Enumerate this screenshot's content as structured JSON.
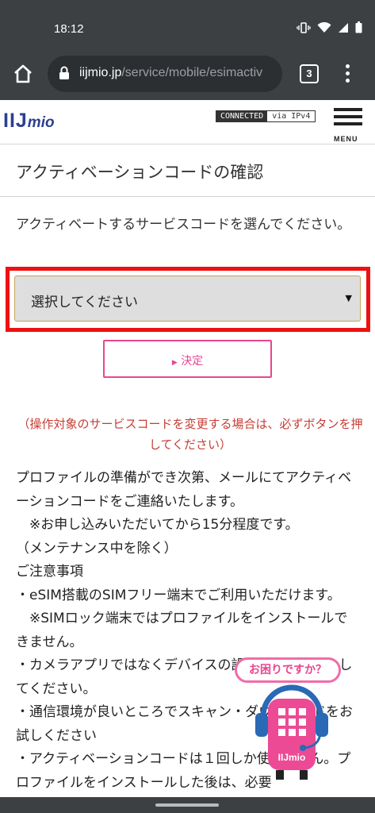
{
  "status_bar": {
    "time": "18:12"
  },
  "browser": {
    "url_host": "iijmio.jp",
    "url_path": "/service/mobile/esimactiv",
    "tab_count": "3"
  },
  "site": {
    "logo_main": "IIJ",
    "logo_sub": "mio",
    "connected_label": "CONNECTED",
    "connected_via": "via IPv4",
    "menu_label": "MENU"
  },
  "page": {
    "title": "アクティベーションコードの確認",
    "instruction": "アクティベートするサービスコードを選んでください。",
    "select_value": "選択してください",
    "submit_label": "決定",
    "warning": "（操作対象のサービスコードを変更する場合は、必ずボタンを押してください）",
    "body": [
      "プロファイルの準備ができ次第、メールにてアクティベーションコードをご連絡いたします。",
      "　※お申し込みいただいてから15分程度です。",
      "（メンテナンス中を除く）",
      "ご注意事項",
      "・eSIM搭載のSIMフリー端末でご利用いただけます。",
      "　※SIMロック端末ではプロファイルをインストールできません。",
      "・カメラアプリではなくデバイスの設定からスキャンしてください。",
      "・通信環境が良いところでスキャン・ダウンロードをお試しください",
      "・アクティベーションコードは１回しか使えません。プロファイルをインストールした後は、必要"
    ]
  },
  "help_widget": {
    "bubble_text": "お困りですか？",
    "badge": "IIJmio"
  },
  "colors": {
    "accent_pink": "#e8468f",
    "warning_red": "#c63d35",
    "highlight_red": "#ee1111",
    "brand_navy": "#2d3f8f"
  }
}
